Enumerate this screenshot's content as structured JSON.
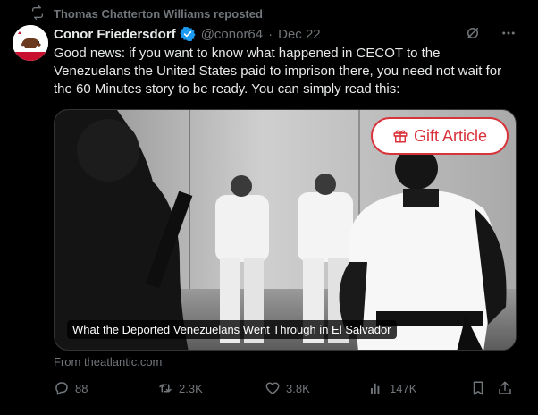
{
  "repost": {
    "label": "Thomas Chatterton Williams reposted"
  },
  "tweet": {
    "author_name": "Conor Friedersdorf",
    "handle": "@conor64",
    "separator": "·",
    "date": "Dec 22",
    "text": "Good news: if you want to know what happened in CECOT to the Venezuelans the United States paid to imprison there, you need not wait for the 60 Minutes story to be ready. You can simply read this:"
  },
  "card": {
    "gift_label": "Gift Article",
    "caption": "What the Deported Venezuelans Went Through in El Salvador",
    "source": "From theatlantic.com"
  },
  "actions": {
    "replies": "88",
    "reposts": "2.3K",
    "likes": "3.8K",
    "views": "147K"
  },
  "colors": {
    "background": "#000000",
    "text": "#e7e9ea",
    "muted": "#71767b",
    "verified": "#1d9bf0",
    "gift_accent": "#d8323a"
  },
  "icons": {
    "repost": "repost-icon",
    "verified": "verified-badge-icon",
    "grok": "grok-icon",
    "more": "more-icon",
    "gift": "gift-icon",
    "reply": "reply-icon",
    "retweet": "retweet-icon",
    "like": "heart-icon",
    "views": "views-icon",
    "bookmark": "bookmark-icon",
    "share": "share-icon"
  }
}
